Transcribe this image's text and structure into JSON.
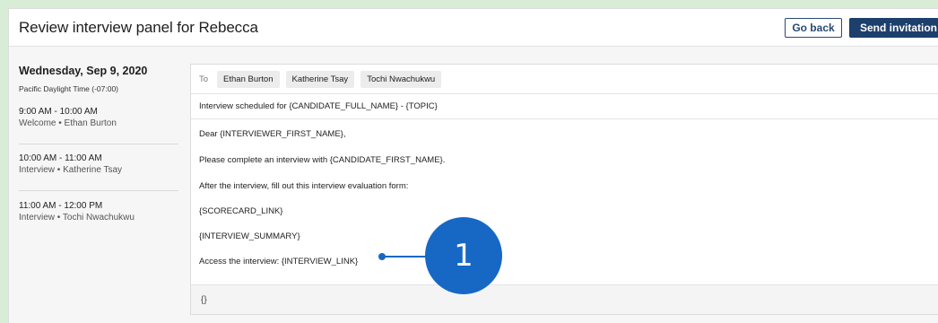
{
  "header": {
    "title": "Review interview panel for Rebecca",
    "go_back_label": "Go back",
    "send_label": "Send invitation"
  },
  "sidebar": {
    "date": "Wednesday, Sep 9, 2020",
    "timezone": "Pacific Daylight Time (-07:00)",
    "slots": [
      {
        "time": "9:00 AM - 10:00 AM",
        "desc": "Welcome • Ethan Burton"
      },
      {
        "time": "10:00 AM - 11:00 AM",
        "desc": "Interview • Katherine Tsay"
      },
      {
        "time": "11:00 AM - 12:00 PM",
        "desc": "Interview • Tochi Nwachukwu"
      }
    ]
  },
  "email": {
    "to_label": "To",
    "recipients": [
      "Ethan Burton",
      "Katherine Tsay",
      "Tochi Nwachukwu"
    ],
    "subject": "Interview scheduled for {CANDIDATE_FULL_NAME} - {TOPIC}",
    "body_lines": [
      "Dear {INTERVIEWER_FIRST_NAME},",
      "Please complete an interview with {CANDIDATE_FIRST_NAME}.",
      "After the interview, fill out this interview evaluation form:",
      "{SCORECARD_LINK}",
      "{INTERVIEW_SUMMARY}",
      "Access the interview: {INTERVIEW_LINK}"
    ],
    "footer_token": "{}"
  },
  "callout": {
    "number": "1",
    "color": "#1668c4"
  },
  "colors": {
    "background": "#d8edd6",
    "primary_button": "#1d3f6c"
  }
}
